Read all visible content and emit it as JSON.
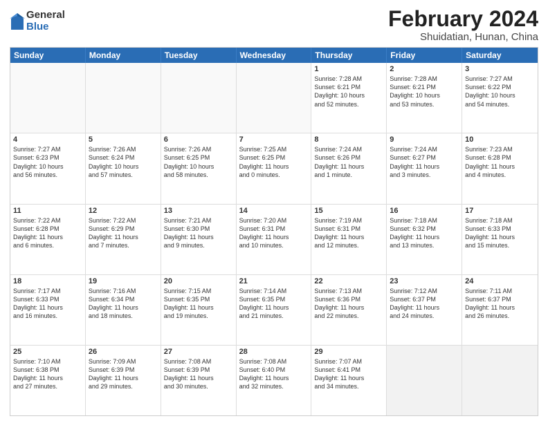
{
  "logo": {
    "general": "General",
    "blue": "Blue"
  },
  "title": "February 2024",
  "subtitle": "Shuidatian, Hunan, China",
  "weekdays": [
    "Sunday",
    "Monday",
    "Tuesday",
    "Wednesday",
    "Thursday",
    "Friday",
    "Saturday"
  ],
  "rows": [
    [
      {
        "day": "",
        "info": "",
        "empty": true
      },
      {
        "day": "",
        "info": "",
        "empty": true
      },
      {
        "day": "",
        "info": "",
        "empty": true
      },
      {
        "day": "",
        "info": "",
        "empty": true
      },
      {
        "day": "1",
        "info": "Sunrise: 7:28 AM\nSunset: 6:21 PM\nDaylight: 10 hours\nand 52 minutes."
      },
      {
        "day": "2",
        "info": "Sunrise: 7:28 AM\nSunset: 6:21 PM\nDaylight: 10 hours\nand 53 minutes."
      },
      {
        "day": "3",
        "info": "Sunrise: 7:27 AM\nSunset: 6:22 PM\nDaylight: 10 hours\nand 54 minutes."
      }
    ],
    [
      {
        "day": "4",
        "info": "Sunrise: 7:27 AM\nSunset: 6:23 PM\nDaylight: 10 hours\nand 56 minutes."
      },
      {
        "day": "5",
        "info": "Sunrise: 7:26 AM\nSunset: 6:24 PM\nDaylight: 10 hours\nand 57 minutes."
      },
      {
        "day": "6",
        "info": "Sunrise: 7:26 AM\nSunset: 6:25 PM\nDaylight: 10 hours\nand 58 minutes."
      },
      {
        "day": "7",
        "info": "Sunrise: 7:25 AM\nSunset: 6:25 PM\nDaylight: 11 hours\nand 0 minutes."
      },
      {
        "day": "8",
        "info": "Sunrise: 7:24 AM\nSunset: 6:26 PM\nDaylight: 11 hours\nand 1 minute."
      },
      {
        "day": "9",
        "info": "Sunrise: 7:24 AM\nSunset: 6:27 PM\nDaylight: 11 hours\nand 3 minutes."
      },
      {
        "day": "10",
        "info": "Sunrise: 7:23 AM\nSunset: 6:28 PM\nDaylight: 11 hours\nand 4 minutes."
      }
    ],
    [
      {
        "day": "11",
        "info": "Sunrise: 7:22 AM\nSunset: 6:28 PM\nDaylight: 11 hours\nand 6 minutes."
      },
      {
        "day": "12",
        "info": "Sunrise: 7:22 AM\nSunset: 6:29 PM\nDaylight: 11 hours\nand 7 minutes."
      },
      {
        "day": "13",
        "info": "Sunrise: 7:21 AM\nSunset: 6:30 PM\nDaylight: 11 hours\nand 9 minutes."
      },
      {
        "day": "14",
        "info": "Sunrise: 7:20 AM\nSunset: 6:31 PM\nDaylight: 11 hours\nand 10 minutes."
      },
      {
        "day": "15",
        "info": "Sunrise: 7:19 AM\nSunset: 6:31 PM\nDaylight: 11 hours\nand 12 minutes."
      },
      {
        "day": "16",
        "info": "Sunrise: 7:18 AM\nSunset: 6:32 PM\nDaylight: 11 hours\nand 13 minutes."
      },
      {
        "day": "17",
        "info": "Sunrise: 7:18 AM\nSunset: 6:33 PM\nDaylight: 11 hours\nand 15 minutes."
      }
    ],
    [
      {
        "day": "18",
        "info": "Sunrise: 7:17 AM\nSunset: 6:33 PM\nDaylight: 11 hours\nand 16 minutes."
      },
      {
        "day": "19",
        "info": "Sunrise: 7:16 AM\nSunset: 6:34 PM\nDaylight: 11 hours\nand 18 minutes."
      },
      {
        "day": "20",
        "info": "Sunrise: 7:15 AM\nSunset: 6:35 PM\nDaylight: 11 hours\nand 19 minutes."
      },
      {
        "day": "21",
        "info": "Sunrise: 7:14 AM\nSunset: 6:35 PM\nDaylight: 11 hours\nand 21 minutes."
      },
      {
        "day": "22",
        "info": "Sunrise: 7:13 AM\nSunset: 6:36 PM\nDaylight: 11 hours\nand 22 minutes."
      },
      {
        "day": "23",
        "info": "Sunrise: 7:12 AM\nSunset: 6:37 PM\nDaylight: 11 hours\nand 24 minutes."
      },
      {
        "day": "24",
        "info": "Sunrise: 7:11 AM\nSunset: 6:37 PM\nDaylight: 11 hours\nand 26 minutes."
      }
    ],
    [
      {
        "day": "25",
        "info": "Sunrise: 7:10 AM\nSunset: 6:38 PM\nDaylight: 11 hours\nand 27 minutes."
      },
      {
        "day": "26",
        "info": "Sunrise: 7:09 AM\nSunset: 6:39 PM\nDaylight: 11 hours\nand 29 minutes."
      },
      {
        "day": "27",
        "info": "Sunrise: 7:08 AM\nSunset: 6:39 PM\nDaylight: 11 hours\nand 30 minutes."
      },
      {
        "day": "28",
        "info": "Sunrise: 7:08 AM\nSunset: 6:40 PM\nDaylight: 11 hours\nand 32 minutes."
      },
      {
        "day": "29",
        "info": "Sunrise: 7:07 AM\nSunset: 6:41 PM\nDaylight: 11 hours\nand 34 minutes."
      },
      {
        "day": "",
        "info": "",
        "empty": true,
        "shaded": true
      },
      {
        "day": "",
        "info": "",
        "empty": true,
        "shaded": true
      }
    ]
  ]
}
